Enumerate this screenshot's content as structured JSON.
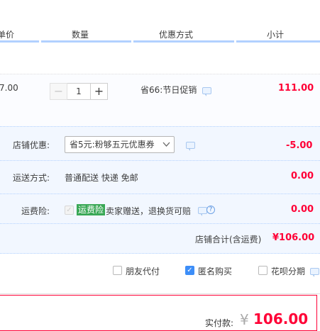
{
  "header": {
    "col_price": "单价",
    "col_qty": "数量",
    "col_promo": "优惠方式",
    "col_subtotal": "小计"
  },
  "item": {
    "unit_price": "7.00",
    "qty_minus": "−",
    "qty_value": "1",
    "qty_plus": "+",
    "promo": "省66:节日促销",
    "subtotal": "111.00"
  },
  "store": {
    "discount_label": "店铺优惠:",
    "discount_select": "省5元:粉够五元优惠券",
    "discount_value": "-5.00",
    "shipping_label": "运送方式:",
    "shipping_text": "普通配送 快递 免邮",
    "shipping_value": "0.00",
    "insurance_label": "运费险:",
    "insurance_tag": "运费险",
    "insurance_text": "卖家赠送，退换货可赔",
    "insurance_value": "0.00",
    "question_mark": "?",
    "total_label": "店铺合计(含运费)",
    "total_value": "¥106.00"
  },
  "options": {
    "friend_pay": "朋友代付",
    "anonymous": "匿名购买",
    "huabei": "花呗分期"
  },
  "footer": {
    "pay_label": "实付款:",
    "currency": "¥",
    "pay_amount": "106.00"
  },
  "colors": {
    "accent_red": "#ff0036",
    "accent_blue": "#3d8ef8",
    "insurance_green": "#3aa856"
  }
}
